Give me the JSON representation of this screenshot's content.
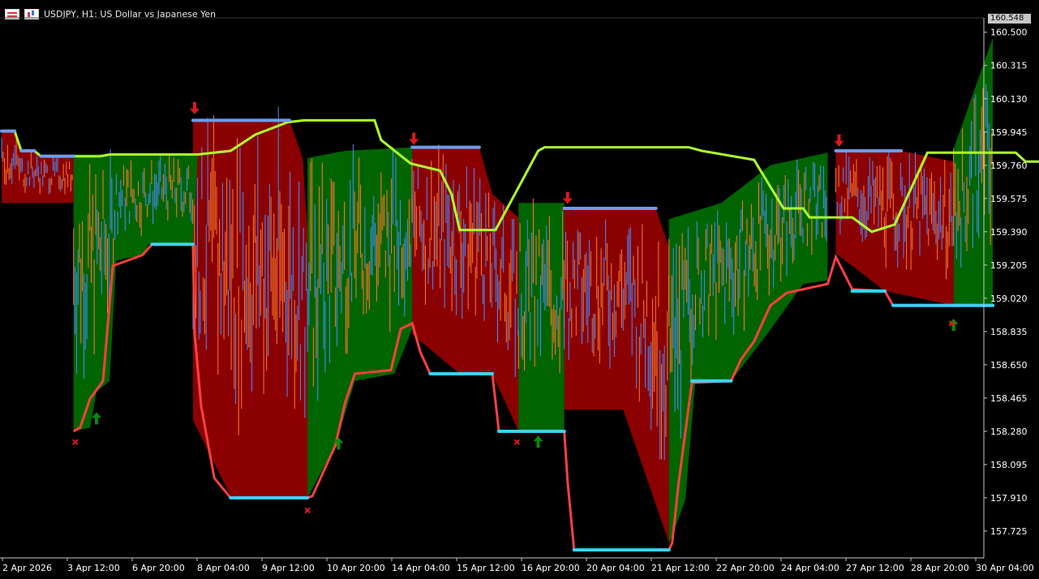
{
  "header": {
    "symbol_title": "USDJPY, H1:  US Dollar vs Japanese Yen",
    "icons": [
      "table-icon",
      "chart-icon"
    ]
  },
  "price_badge": "160.548",
  "colors": {
    "background": "#000000",
    "bull_fill": "#006400",
    "bear_fill": "#8b0000",
    "upper_line": "#adff2f",
    "lower_line": "#ff4040",
    "level_marker": "#3fd2ff",
    "upper_marker": "#6d9cf0",
    "arrow_up": "#0a8a0a",
    "arrow_down": "#e01818",
    "cross": "#e01818",
    "axis_text": "#ffffff",
    "axis_line": "#c8c8c8"
  },
  "chart_data": {
    "type": "line",
    "title": "USDJPY, H1:  US Dollar vs Japanese Yen",
    "y_ticks": [
      "160.500",
      "160.315",
      "160.130",
      "159.945",
      "159.760",
      "159.575",
      "159.390",
      "159.205",
      "159.020",
      "158.835",
      "158.650",
      "158.465",
      "158.280",
      "158.095",
      "157.910",
      "157.725"
    ],
    "x_labels": [
      "2 Apr 2026",
      "3 Apr 12:00",
      "6 Apr 20:00",
      "8 Apr 04:00",
      "9 Apr 12:00",
      "10 Apr 20:00",
      "14 Apr 04:00",
      "15 Apr 12:00",
      "16 Apr 20:00",
      "20 Apr 04:00",
      "21 Apr 12:00",
      "22 Apr 20:00",
      "24 Apr 04:00",
      "27 Apr 12:00",
      "28 Apr 20:00",
      "30 Apr 04:00"
    ],
    "ylim": [
      157.58,
      160.58
    ],
    "last_price": 160.548,
    "note_units": "x = bar index (0..600), y = price",
    "upper_line": [
      [
        0,
        159.95
      ],
      [
        8,
        159.95
      ],
      [
        12,
        159.84
      ],
      [
        20,
        159.84
      ],
      [
        24,
        159.81
      ],
      [
        60,
        159.81
      ],
      [
        66,
        159.82
      ],
      [
        120,
        159.82
      ],
      [
        140,
        159.84
      ],
      [
        155,
        159.93
      ],
      [
        175,
        160.0
      ],
      [
        185,
        160.01
      ],
      [
        228,
        160.01
      ],
      [
        232,
        159.9
      ],
      [
        250,
        159.77
      ],
      [
        268,
        159.73
      ],
      [
        275,
        159.6
      ],
      [
        280,
        159.4
      ],
      [
        302,
        159.4
      ],
      [
        328,
        159.84
      ],
      [
        332,
        159.86
      ],
      [
        420,
        159.86
      ],
      [
        428,
        159.84
      ],
      [
        460,
        159.79
      ],
      [
        478,
        159.52
      ],
      [
        490,
        159.52
      ],
      [
        494,
        159.47
      ],
      [
        520,
        159.47
      ],
      [
        532,
        159.39
      ],
      [
        546,
        159.43
      ],
      [
        566,
        159.83
      ],
      [
        620,
        159.83
      ],
      [
        626,
        159.78
      ],
      [
        700,
        159.78
      ],
      [
        718,
        159.79
      ],
      [
        724,
        159.96
      ],
      [
        772,
        159.96
      ],
      [
        780,
        159.93
      ],
      [
        790,
        159.68
      ],
      [
        800,
        159.64
      ]
    ],
    "bull_segments": [
      {
        "from": 44,
        "to": 117,
        "top": [
          [
            44,
            159.82
          ],
          [
            66,
            159.82
          ],
          [
            120,
            159.82
          ]
        ],
        "bottom": [
          [
            44,
            158.28
          ],
          [
            54,
            158.3
          ],
          [
            58,
            158.5
          ],
          [
            66,
            158.56
          ],
          [
            70,
            159.23
          ],
          [
            86,
            159.26
          ],
          [
            90,
            159.32
          ],
          [
            117,
            159.32
          ]
        ]
      },
      {
        "from": 187,
        "to": 251,
        "top": [
          [
            187,
            159.8
          ],
          [
            210,
            159.84
          ],
          [
            251,
            159.86
          ]
        ],
        "bottom": [
          [
            187,
            157.91
          ],
          [
            204,
            158.2
          ],
          [
            216,
            158.56
          ],
          [
            240,
            158.6
          ],
          [
            251,
            158.85
          ]
        ]
      },
      {
        "from": 316,
        "to": 344,
        "top": [
          [
            316,
            159.55
          ],
          [
            330,
            159.55
          ],
          [
            344,
            159.55
          ]
        ],
        "bottom": [
          [
            316,
            158.28
          ],
          [
            344,
            158.28
          ]
        ]
      },
      {
        "from": 408,
        "to": 505,
        "top": [
          [
            408,
            159.46
          ],
          [
            440,
            159.55
          ],
          [
            470,
            159.76
          ],
          [
            505,
            159.83
          ]
        ],
        "bottom": [
          [
            408,
            157.65
          ],
          [
            418,
            157.9
          ],
          [
            424,
            158.55
          ],
          [
            446,
            158.56
          ],
          [
            468,
            158.82
          ],
          [
            490,
            159.1
          ],
          [
            505,
            159.12
          ]
        ]
      },
      {
        "from": 582,
        "to": 606,
        "top": [
          [
            582,
            159.85
          ],
          [
            606,
            160.47
          ]
        ],
        "bottom": [
          [
            582,
            158.98
          ],
          [
            606,
            158.98
          ]
        ]
      }
    ],
    "bear_segments": [
      {
        "from": 0,
        "to": 44,
        "top": [
          [
            0,
            159.95
          ],
          [
            8,
            159.95
          ],
          [
            12,
            159.84
          ],
          [
            20,
            159.84
          ],
          [
            24,
            159.81
          ],
          [
            44,
            159.81
          ]
        ],
        "bottom": [
          [
            0,
            159.55
          ],
          [
            44,
            159.55
          ]
        ]
      },
      {
        "from": 117,
        "to": 187,
        "top": [
          [
            117,
            160.01
          ],
          [
            176,
            160.01
          ],
          [
            184,
            159.8
          ],
          [
            187,
            159.4
          ]
        ],
        "bottom": [
          [
            117,
            158.34
          ],
          [
            140,
            157.92
          ],
          [
            187,
            157.91
          ]
        ]
      },
      {
        "from": 251,
        "to": 316,
        "top": [
          [
            251,
            159.86
          ],
          [
            292,
            159.86
          ],
          [
            300,
            159.6
          ],
          [
            316,
            159.47
          ]
        ],
        "bottom": [
          [
            251,
            158.82
          ],
          [
            280,
            158.6
          ],
          [
            300,
            158.6
          ],
          [
            316,
            158.28
          ]
        ]
      },
      {
        "from": 344,
        "to": 408,
        "top": [
          [
            344,
            159.52
          ],
          [
            400,
            159.52
          ],
          [
            408,
            159.3
          ]
        ],
        "bottom": [
          [
            344,
            158.4
          ],
          [
            380,
            158.4
          ],
          [
            408,
            157.66
          ]
        ]
      },
      {
        "from": 510,
        "to": 582,
        "top": [
          [
            510,
            159.85
          ],
          [
            550,
            159.84
          ],
          [
            582,
            159.78
          ]
        ],
        "bottom": [
          [
            510,
            159.27
          ],
          [
            540,
            159.06
          ],
          [
            582,
            158.98
          ]
        ]
      }
    ],
    "lower_line": [
      [
        44,
        158.28
      ],
      [
        48,
        158.3
      ],
      [
        54,
        158.46
      ],
      [
        62,
        158.56
      ],
      [
        68,
        159.2
      ],
      [
        86,
        159.26
      ],
      [
        92,
        159.32
      ],
      [
        117,
        159.32
      ],
      [
        118,
        158.82
      ],
      [
        122,
        158.42
      ],
      [
        130,
        158.02
      ],
      [
        140,
        157.91
      ],
      [
        187,
        157.91
      ],
      [
        190,
        157.92
      ],
      [
        204,
        158.2
      ],
      [
        210,
        158.44
      ],
      [
        216,
        158.6
      ],
      [
        238,
        158.62
      ],
      [
        244,
        158.85
      ],
      [
        251,
        158.88
      ],
      [
        256,
        158.72
      ],
      [
        262,
        158.6
      ],
      [
        300,
        158.6
      ],
      [
        304,
        158.28
      ],
      [
        344,
        158.28
      ],
      [
        346,
        158.0
      ],
      [
        350,
        157.62
      ],
      [
        408,
        157.62
      ],
      [
        410,
        157.66
      ],
      [
        414,
        158.0
      ],
      [
        422,
        158.55
      ],
      [
        446,
        158.56
      ],
      [
        452,
        158.68
      ],
      [
        460,
        158.78
      ],
      [
        470,
        158.98
      ],
      [
        480,
        159.05
      ],
      [
        505,
        159.1
      ],
      [
        510,
        159.25
      ],
      [
        520,
        159.07
      ],
      [
        540,
        159.06
      ],
      [
        545,
        158.98
      ],
      [
        582,
        158.98
      ],
      [
        606,
        158.98
      ]
    ],
    "signals": {
      "arrows_up": [
        [
          58,
          158.35
        ],
        [
          206,
          158.21
        ],
        [
          328,
          158.22
        ],
        [
          582,
          158.87
        ]
      ],
      "arrows_down": [
        [
          118,
          160.08
        ],
        [
          252,
          159.91
        ],
        [
          346,
          159.58
        ],
        [
          512,
          159.9
        ]
      ],
      "crosses": [
        [
          45,
          158.22
        ],
        [
          187,
          157.84
        ],
        [
          315,
          158.22
        ],
        [
          581,
          158.88
        ]
      ]
    }
  }
}
